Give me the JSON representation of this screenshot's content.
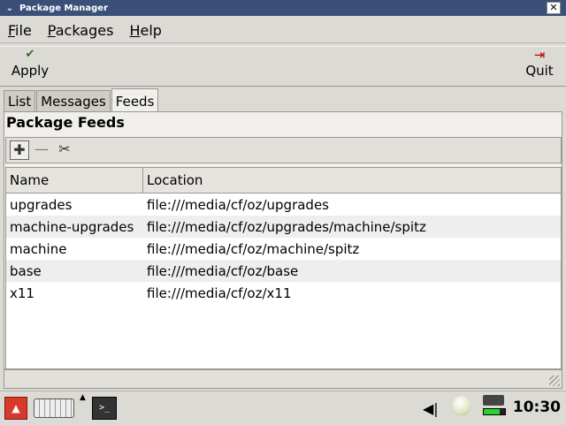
{
  "window": {
    "title": "Package Manager",
    "menu_arrow": "✔",
    "close_label": "✕"
  },
  "menubar": [
    {
      "key": "F",
      "rest": "ile"
    },
    {
      "key": "P",
      "rest": "ackages"
    },
    {
      "key": "H",
      "rest": "elp"
    }
  ],
  "toolbar": {
    "apply_label": "Apply",
    "apply_icon": "check-icon",
    "quit_label": "Quit",
    "quit_icon": "exit-icon"
  },
  "tabs": [
    "List",
    "Messages",
    "Feeds"
  ],
  "active_tab": "Feeds",
  "panel": {
    "title": "Package Feeds"
  },
  "feed_table": {
    "columns": [
      "Name",
      "Location"
    ],
    "rows": [
      [
        "upgrades",
        "file:///media/cf/oz/upgrades"
      ],
      [
        "machine-upgrades",
        "file:///media/cf/oz/upgrades/machine/spitz"
      ],
      [
        "machine",
        "file:///media/cf/oz/machine/spitz"
      ],
      [
        "base",
        "file:///media/cf/oz/base"
      ],
      [
        "x11",
        "file:///media/cf/oz/x11"
      ]
    ]
  },
  "statusbar": {
    "text": ""
  },
  "taskbar": {
    "clock": "10:30",
    "battery_level": 0.75,
    "accent": "#d63a2c"
  }
}
